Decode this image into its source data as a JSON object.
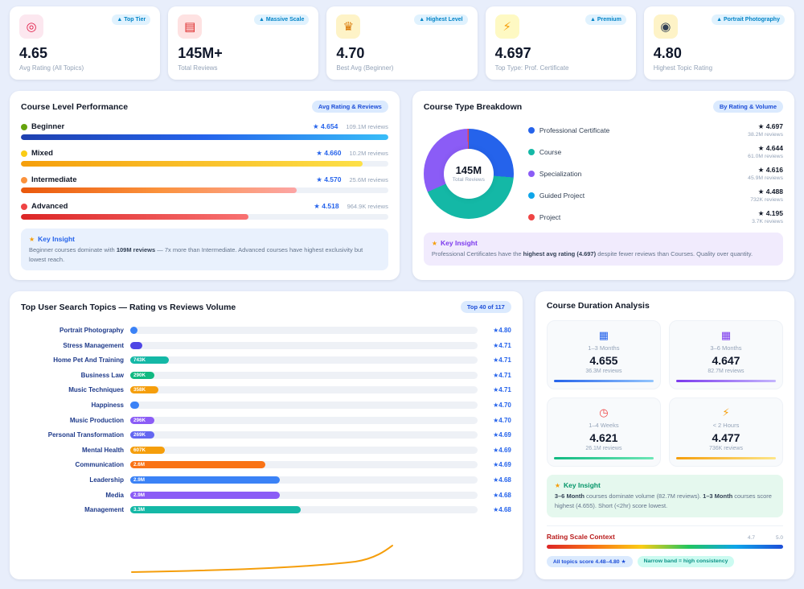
{
  "theme": {
    "background": "#e8eefb",
    "card": "#ffffff",
    "accent_blue": "#2563eb",
    "accent_teal": "#14b8a6",
    "accent_purple": "#8b5cf6",
    "accent_orange": "#f97316",
    "accent_red": "#ef4444"
  },
  "kpis": [
    {
      "icon_name": "target-icon",
      "icon_glyph": "◎",
      "icon_style": "background:#fce7ef;color:#e11d48",
      "badge": "▲ Top Tier",
      "value": "4.65",
      "label": "Avg Rating (All Topics)"
    },
    {
      "icon_name": "books-icon",
      "icon_glyph": "▤",
      "icon_style": "background:#fee2e2;color:#dc2626",
      "badge": "▲ Massive Scale",
      "value": "145M+",
      "label": "Total Reviews"
    },
    {
      "icon_name": "trophy-icon",
      "icon_glyph": "♛",
      "icon_style": "background:#fef3c7;color:#d97706",
      "badge": "▲ Highest Level",
      "value": "4.70",
      "label": "Best Avg (Beginner)"
    },
    {
      "icon_name": "lightning-icon",
      "icon_glyph": "⚡",
      "icon_style": "background:#fef9c3;color:#f59e0b",
      "badge": "▲ Premium",
      "value": "4.697",
      "label": "Top Type: Prof. Certificate"
    },
    {
      "icon_name": "camera-icon",
      "icon_glyph": "◉",
      "icon_style": "background:#fef3c7;color:#334155",
      "badge": "▲ Portrait Photography",
      "value": "4.80",
      "label": "Highest Topic Rating"
    }
  ],
  "course_level": {
    "title": "Course Level Performance",
    "badge": "Avg Rating & Reviews",
    "rows": [
      {
        "label": "Beginner",
        "rating": "★ 4.654",
        "reviews": "109.1M reviews",
        "dot_style": "background:#65a30d",
        "bar_style": "width:100%;background:linear-gradient(90deg,#1e40af,#2563eb,#38bdf8)"
      },
      {
        "label": "Mixed",
        "rating": "★ 4.660",
        "reviews": "10.2M reviews",
        "dot_style": "background:#facc15",
        "bar_style": "width:93%;background:linear-gradient(90deg,#f59e0b,#fde047)"
      },
      {
        "label": "Intermediate",
        "rating": "★ 4.570",
        "reviews": "25.6M reviews",
        "dot_style": "background:#fb923c",
        "bar_style": "width:75%;background:linear-gradient(90deg,#ea580c,#fb923c,#fca5a5)"
      },
      {
        "label": "Advanced",
        "rating": "★ 4.518",
        "reviews": "964.9K reviews",
        "dot_style": "background:#ef4444",
        "bar_style": "width:62%;background:linear-gradient(90deg,#dc2626,#f87171)"
      }
    ],
    "insight": {
      "icon": "💡",
      "title": "Key Insight",
      "parts": [
        {
          "text": "Beginner courses dominate with "
        },
        {
          "text": "109M reviews"
        },
        {
          "text": " — 7x more than Intermediate. Advanced courses have highest exclusivity but lowest reach."
        }
      ]
    }
  },
  "course_type": {
    "title": "Course Type Breakdown",
    "badge": "By Rating & Volume",
    "donut_style": "background:conic-gradient(#2563eb 0 26.3%, #14b8a6 26.3% 68.4%, #8b5cf6 68.4% 99.5%, #ef4444 99.5% 100%)",
    "center_value": "145M",
    "center_label": "Total Reviews",
    "legend": [
      {
        "name": "Professional Certificate",
        "dot_style": "background:#2563eb",
        "rating": "★ 4.697",
        "reviews": "38.2M reviews"
      },
      {
        "name": "Course",
        "dot_style": "background:#14b8a6",
        "rating": "★ 4.644",
        "reviews": "61.0M reviews"
      },
      {
        "name": "Specialization",
        "dot_style": "background:#8b5cf6",
        "rating": "★ 4.616",
        "reviews": "45.9M reviews"
      },
      {
        "name": "Guided Project",
        "dot_style": "background:#0ea5e9",
        "rating": "★ 4.488",
        "reviews": "732K reviews"
      },
      {
        "name": "Project",
        "dot_style": "background:#ef4444",
        "rating": "★ 4.195",
        "reviews": "3.7K reviews"
      }
    ],
    "insight": {
      "icon": "💡",
      "title": "Key Insight",
      "parts": [
        {
          "text": "Professional Certificates have the "
        },
        {
          "text": "highest avg rating (4.697)"
        },
        {
          "text": " despite fewer reviews than Courses. Quality over quantity."
        }
      ]
    }
  },
  "topics": {
    "title": "Top User Search Topics — Rating vs Reviews Volume",
    "badge": "Top 40 of 117",
    "rows": [
      {
        "label": "Portrait Photography",
        "value": "",
        "rating": "★4.80",
        "bar_style": "width:2%;background:#3b82f6"
      },
      {
        "label": "Stress Management",
        "value": "",
        "rating": "★4.71",
        "bar_style": "width:3.5%;background:#4f46e5"
      },
      {
        "label": "Home Pet And Training",
        "value": "743K",
        "rating": "★4.71",
        "bar_style": "width:11%;background:#14b8a6"
      },
      {
        "label": "Business Law",
        "value": "290K",
        "rating": "★4.71",
        "bar_style": "width:7%;background:#10b981"
      },
      {
        "label": "Music Techniques",
        "value": "358K",
        "rating": "★4.71",
        "bar_style": "width:8%;background:#f59e0b"
      },
      {
        "label": "Happiness",
        "value": "",
        "rating": "★4.70",
        "bar_style": "width:2.5%;background:#3b82f6"
      },
      {
        "label": "Music Production",
        "value": "296K",
        "rating": "★4.70",
        "bar_style": "width:7%;background:#8b5cf6"
      },
      {
        "label": "Personal Transformation",
        "value": "269K",
        "rating": "★4.69",
        "bar_style": "width:7%;background:#6366f1"
      },
      {
        "label": "Mental Health",
        "value": "607K",
        "rating": "★4.69",
        "bar_style": "width:10%;background:#f59e0b"
      },
      {
        "label": "Communication",
        "value": "2.6M",
        "rating": "★4.69",
        "bar_style": "width:39%;background:#f97316"
      },
      {
        "label": "Leadership",
        "value": "2.9M",
        "rating": "★4.68",
        "bar_style": "width:43%;background:#3b82f6"
      },
      {
        "label": "Media",
        "value": "2.9M",
        "rating": "★4.68",
        "bar_style": "width:43%;background:#8b5cf6"
      },
      {
        "label": "Management",
        "value": "3.3M",
        "rating": "★4.68",
        "bar_style": "width:49%;background:#14b8a6"
      }
    ]
  },
  "duration": {
    "title": "Course Duration Analysis",
    "cards": [
      {
        "icon_name": "calendar-icon",
        "icon_glyph": "▦",
        "icon_style": "color:#2563eb",
        "label": "1–3 Months",
        "value": "4.655",
        "reviews": "36.3M reviews",
        "bar_style": "background:linear-gradient(90deg,#2563eb,#93c5fd)"
      },
      {
        "icon_name": "calendar-icon",
        "icon_glyph": "▦",
        "icon_style": "color:#7c3aed",
        "label": "3–6 Months",
        "value": "4.647",
        "reviews": "82.7M reviews",
        "bar_style": "background:linear-gradient(90deg,#7c3aed,#c4b5fd)"
      },
      {
        "icon_name": "alarm-clock-icon",
        "icon_glyph": "◷",
        "icon_style": "color:#ef4444",
        "label": "1–4 Weeks",
        "value": "4.621",
        "reviews": "26.1M reviews",
        "bar_style": "background:linear-gradient(90deg,#10b981,#6ee7b7)"
      },
      {
        "icon_name": "lightning-icon",
        "icon_glyph": "⚡",
        "icon_style": "color:#f59e0b",
        "label": "< 2 Hours",
        "value": "4.477",
        "reviews": "736K reviews",
        "bar_style": "background:linear-gradient(90deg,#f59e0b,#fde68a)"
      }
    ],
    "insight": {
      "icon": "💡",
      "title": "Key Insight",
      "parts": [
        {
          "text": "3–6 Month"
        },
        {
          "text": " courses dominate volume (82.7M reviews). "
        },
        {
          "text": "1–3 Month"
        },
        {
          "text": " courses score highest (4.655). Short (<2hr) score lowest."
        }
      ]
    },
    "scale": {
      "title": "Rating Scale Context",
      "tick_mid": "4.7",
      "tick_max": "5.0",
      "bar_style": "background:linear-gradient(90deg,#dc2626,#f97316,#facc15,#22c55e,#0ea5e9,#1d4ed8)",
      "badge_left": "All topics score 4.48–4.80 ★",
      "badge_right": "Narrow band = high consistency"
    }
  },
  "chart_data": [
    {
      "type": "bar",
      "title": "Course Level Performance",
      "orientation": "horizontal",
      "categories": [
        "Beginner",
        "Mixed",
        "Intermediate",
        "Advanced"
      ],
      "series": [
        {
          "name": "Avg Rating",
          "values": [
            4.654,
            4.66,
            4.57,
            4.518
          ]
        },
        {
          "name": "Reviews",
          "values": [
            "109.1M",
            "10.2M",
            "25.6M",
            "964.9K"
          ]
        }
      ],
      "legend_position": "none",
      "grid": false
    },
    {
      "type": "pie",
      "title": "Course Type Breakdown",
      "categories": [
        "Professional Certificate",
        "Course",
        "Specialization",
        "Guided Project",
        "Project"
      ],
      "values": [
        "38.2M",
        "61.0M",
        "45.9M",
        "732K",
        "3.7K"
      ],
      "ratings": [
        4.697,
        4.644,
        4.616,
        4.488,
        4.195
      ],
      "center_label": "145M Total Reviews",
      "legend_position": "right"
    },
    {
      "type": "bar",
      "title": "Top User Search Topics — Rating vs Reviews Volume",
      "orientation": "horizontal",
      "categories": [
        "Portrait Photography",
        "Stress Management",
        "Home Pet And Training",
        "Business Law",
        "Music Techniques",
        "Happiness",
        "Music Production",
        "Personal Transformation",
        "Mental Health",
        "Communication",
        "Leadership",
        "Media",
        "Management"
      ],
      "series": [
        {
          "name": "Reviews",
          "values": [
            null,
            null,
            "743K",
            "290K",
            "358K",
            null,
            "296K",
            "269K",
            "607K",
            "2.6M",
            "2.9M",
            "2.9M",
            "3.3M"
          ]
        },
        {
          "name": "Rating",
          "values": [
            4.8,
            4.71,
            4.71,
            4.71,
            4.71,
            4.7,
            4.7,
            4.69,
            4.69,
            4.69,
            4.68,
            4.68,
            4.68
          ]
        }
      ],
      "grid": false
    },
    {
      "type": "bar",
      "title": "Course Duration Analysis",
      "categories": [
        "1–3 Months",
        "3–6 Months",
        "1–4 Weeks",
        "< 2 Hours"
      ],
      "series": [
        {
          "name": "Avg Rating",
          "values": [
            4.655,
            4.647,
            4.621,
            4.477
          ]
        },
        {
          "name": "Reviews",
          "values": [
            "36.3M",
            "82.7M",
            "26.1M",
            "736K"
          ]
        }
      ],
      "xlim": [
        4.7,
        5.0
      ]
    }
  ]
}
